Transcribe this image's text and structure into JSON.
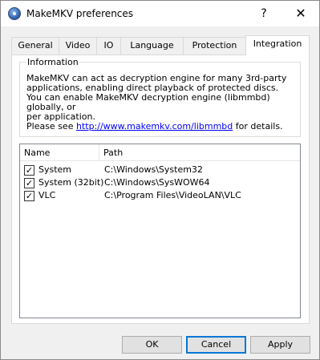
{
  "window": {
    "title": "MakeMKV preferences",
    "help_glyph": "?",
    "close_glyph": "✕"
  },
  "tabs": [
    {
      "label": "General"
    },
    {
      "label": "Video"
    },
    {
      "label": "IO"
    },
    {
      "label": "Language"
    },
    {
      "label": "Protection"
    },
    {
      "label": "Integration",
      "active": true
    }
  ],
  "information": {
    "legend": "Information",
    "line1": "MakeMKV can act as decryption engine for many 3rd-party",
    "line2": "applications, enabling direct playback of protected discs.",
    "line3": "You can enable MakeMKV decryption engine (libmmbd) globally, or",
    "line4": "per application.",
    "line5_prefix": "Please see ",
    "link": "http://www.makemkv.com/libmmbd",
    "line5_suffix": " for details."
  },
  "list": {
    "columns": {
      "name": "Name",
      "path": "Path"
    },
    "rows": [
      {
        "name": "System",
        "path": "C:\\Windows\\System32",
        "checked": true
      },
      {
        "name": "System (32bit)",
        "path": "C:\\Windows\\SysWOW64",
        "checked": true
      },
      {
        "name": "VLC",
        "path": "C:\\Program Files\\VideoLAN\\VLC",
        "checked": true
      }
    ],
    "check_glyph": "✓"
  },
  "buttons": {
    "ok": "OK",
    "cancel": "Cancel",
    "apply": "Apply"
  }
}
